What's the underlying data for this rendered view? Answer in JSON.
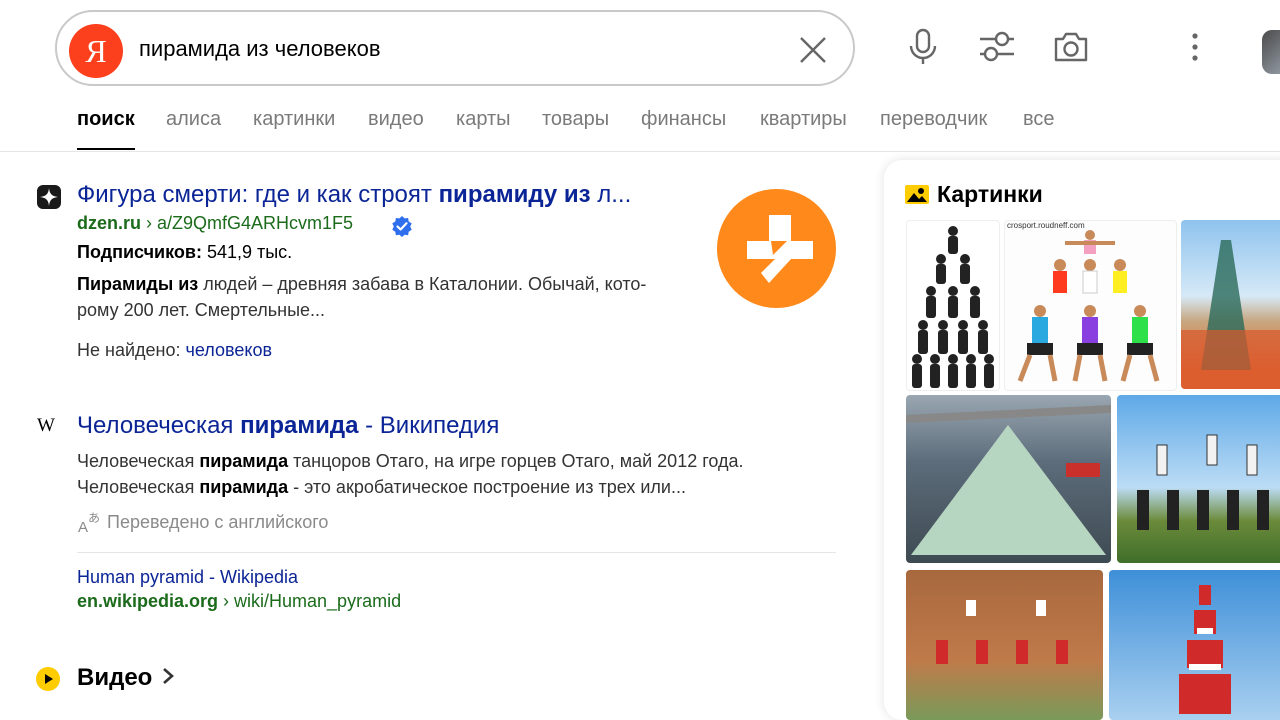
{
  "search": {
    "logo": "Я",
    "query": "пирамида из человеков"
  },
  "tabs": [
    "поиск",
    "алиса",
    "картинки",
    "видео",
    "карты",
    "товары",
    "финансы",
    "квартиры",
    "переводчик",
    "все"
  ],
  "results": [
    {
      "title_pre": "Фигура смерти: где и как строят ",
      "title_bold": "пирамиду из",
      "title_post": " л...",
      "url_host": "dzen.ru",
      "url_path": " › a/Z9QmfG4ARHcvm1F5",
      "subscribers_label": "Подписчиков:",
      "subscribers_value": " 541,9 тыс.",
      "snippet_bold": "Пирамиды из",
      "snippet_1": " людей – древняя забава в Каталонии. Обычай, кото-",
      "snippet_2": "рому 200 лет. Смертельные...",
      "notfound_label": "Не найдено: ",
      "notfound_word": "человеков"
    },
    {
      "title_pre": "Человеческая ",
      "title_bold": "пирамида",
      "title_post": " - Википедия",
      "snippet1_pre": "Человеческая ",
      "snippet1_bold": "пирамида",
      "snippet1_post": " танцоров Отаго, на игре горцев Отаго, май 2012 года.",
      "snippet2_pre": "Человеческая ",
      "snippet2_bold": "пирамида",
      "snippet2_post": " - это акробатическое построение из трех или...",
      "translated": "Переведено с английского",
      "orig_title": "Human pyramid - Wikipedia",
      "orig_host": "en.wikipedia.org",
      "orig_path": " › wiki/Human_pyramid"
    }
  ],
  "video": {
    "label": "Видео"
  },
  "images": {
    "title": "Картинки",
    "caption": "crosport.roudneff.com"
  },
  "colors": {
    "link": "#0b2596",
    "url_green": "#1b6b1b",
    "yandex_red": "#fc3f1d",
    "dzen_orange": "#ff8a1b"
  }
}
